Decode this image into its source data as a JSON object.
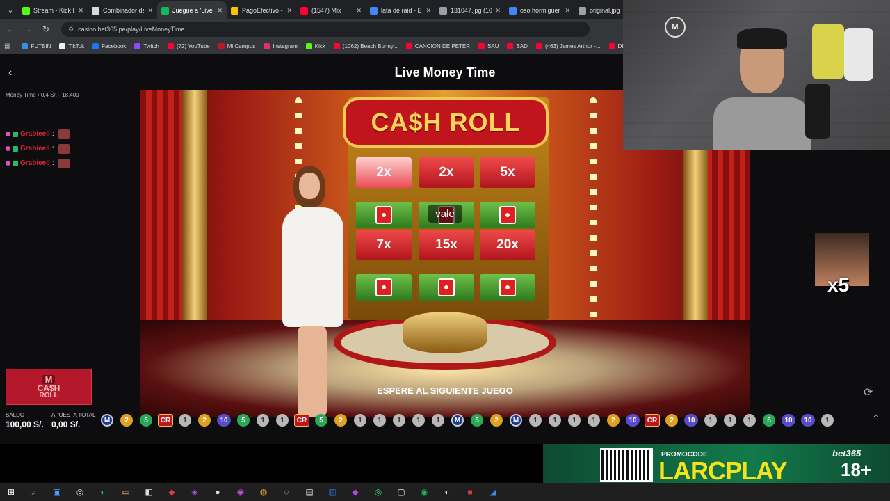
{
  "browser": {
    "tabs": [
      {
        "label": "Stream - Kick L",
        "color": "#53fc18"
      },
      {
        "label": "Combinador de",
        "color": "#d9d9d9"
      },
      {
        "label": "Juegue a 'Live",
        "color": "#1ab55f",
        "active": true
      },
      {
        "label": "PagoEfectivo -",
        "color": "#f5c400"
      },
      {
        "label": "(1547) Mix",
        "color": "#ff0033"
      },
      {
        "label": "lata de raid - E",
        "color": "#4285f4"
      },
      {
        "label": "131047.jpg (10",
        "color": "#9aa0a6"
      },
      {
        "label": "oso hormiguer",
        "color": "#4285f4"
      },
      {
        "label": "original.jpg",
        "color": "#9aa0a6"
      }
    ],
    "url": "casino.bet365.pe/play/LiveMoneyTime",
    "bookmarks": [
      {
        "label": "FUTBIN",
        "color": "#3b8de0"
      },
      {
        "label": "TikTok",
        "color": "#eeeeee"
      },
      {
        "label": "Facebook",
        "color": "#1877f2"
      },
      {
        "label": "Twitch",
        "color": "#9146ff"
      },
      {
        "label": "(72) YouTube",
        "color": "#ff0033"
      },
      {
        "label": "Mi Campus",
        "color": "#c0152b"
      },
      {
        "label": "Instagram",
        "color": "#e1306c"
      },
      {
        "label": "Kick",
        "color": "#53fc18"
      },
      {
        "label": "(1062) Beach Bunny...",
        "color": "#ff0033"
      },
      {
        "label": "CANCION DE PETER",
        "color": "#ff0033"
      },
      {
        "label": "SAU",
        "color": "#ff0033"
      },
      {
        "label": "SAD",
        "color": "#ff0033"
      },
      {
        "label": "(463) James Arthur -...",
        "color": "#ff0033"
      },
      {
        "label": "DRA",
        "color": "#ff0033"
      }
    ]
  },
  "game": {
    "title": "Live Money Time",
    "info": "Money Time • 0,4 S/. - 18.400",
    "sign_text": "CA$H ROLL",
    "multipliers_top": [
      "2x",
      "2x",
      "5x"
    ],
    "multipliers_bottom": [
      "7x",
      "15x",
      "20x"
    ],
    "tooltip": "vale",
    "status_banner": "ESPERE AL SIGUIENTE JUEGO",
    "logo": {
      "m": "M",
      "line1": "CA$H",
      "line2": "ROLL"
    },
    "balance_label": "SALDO",
    "balance_value": "100,00 S/.",
    "bet_label": "APUESTA TOTAL",
    "bet_value": "0,00 S/.",
    "history": [
      "M",
      "2",
      "5",
      "CR",
      "1",
      "2",
      "10",
      "5",
      "1",
      "1",
      "CR",
      "5",
      "2",
      "1",
      "1",
      "1",
      "1",
      "1",
      "M",
      "5",
      "2",
      "M",
      "1",
      "1",
      "1",
      "1",
      "2",
      "10",
      "CR",
      "2",
      "10",
      "1",
      "1",
      "1",
      "5",
      "10",
      "10",
      "1"
    ]
  },
  "chat": [
    {
      "user": "Grabieell",
      "sep": ":"
    },
    {
      "user": "Grabieell",
      "sep": ":"
    },
    {
      "user": "Grabieell",
      "sep": ":"
    }
  ],
  "overlay": {
    "emote_count": "x5",
    "webcam_badge": "M"
  },
  "promo": {
    "label": "PROMOCODE",
    "code": "LARCPLAY",
    "brand": "bet365",
    "age": "18+"
  }
}
